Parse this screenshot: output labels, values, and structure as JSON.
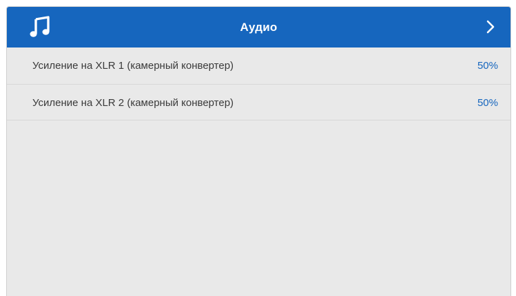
{
  "header": {
    "title": "Аудио",
    "icon": "music-note-icon",
    "next_icon": "chevron-right-icon",
    "color": "#1666be"
  },
  "settings": [
    {
      "label": "Усиление на XLR 1 (камерный конвертер)",
      "value": "50%"
    },
    {
      "label": "Усиление на XLR 2 (камерный конвертер)",
      "value": "50%"
    }
  ],
  "colors": {
    "background": "#e9e9e9",
    "value_text": "#1666be",
    "label_text": "#3a3a3a"
  }
}
